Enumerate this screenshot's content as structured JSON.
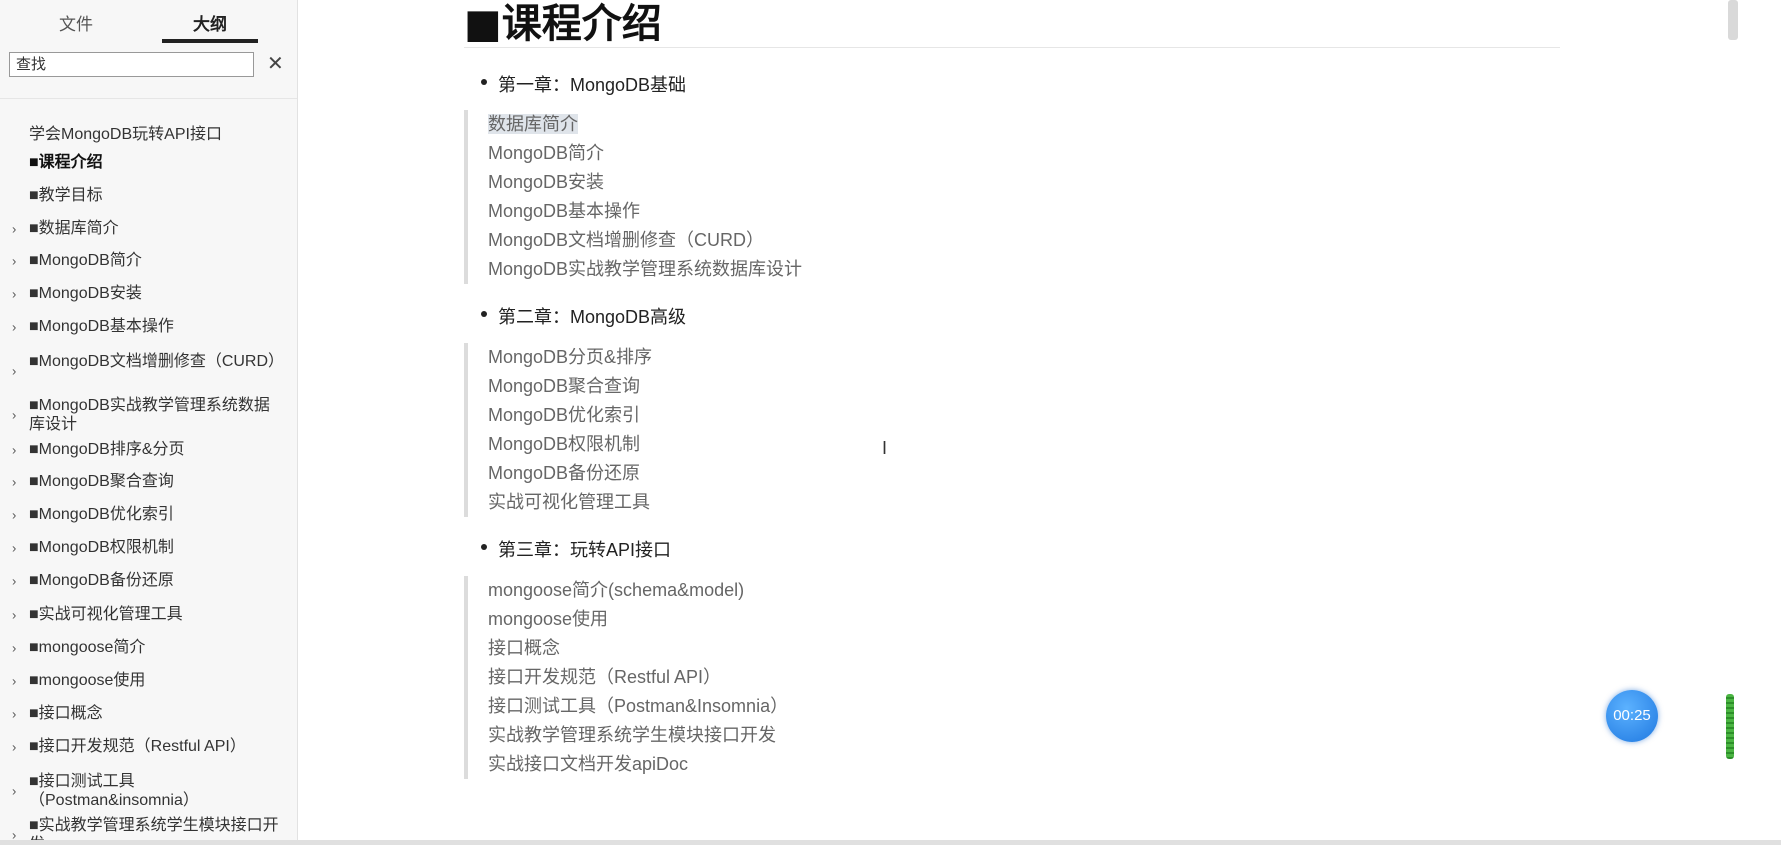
{
  "sidebar": {
    "tabs": {
      "files": "文件",
      "outline": "大纲"
    },
    "search": {
      "placeholder": "查找",
      "close": "✕"
    },
    "items": [
      {
        "label": "学会MongoDB玩转API接口",
        "expandable": false,
        "bold": false
      },
      {
        "label": "■课程介绍",
        "expandable": false,
        "bold": true
      },
      {
        "label": "■教学目标",
        "expandable": false,
        "bold": false
      },
      {
        "label": "■数据库简介",
        "expandable": true,
        "bold": false
      },
      {
        "label": "■MongoDB简介",
        "expandable": true,
        "bold": false
      },
      {
        "label": "■MongoDB安装",
        "expandable": true,
        "bold": false
      },
      {
        "label": "■MongoDB基本操作",
        "expandable": true,
        "bold": false
      },
      {
        "label": "■MongoDB文档增删修查（CURD）",
        "expandable": true,
        "bold": false
      },
      {
        "label": "■MongoDB实战教学管理系统数据库设计",
        "expandable": true,
        "bold": false
      },
      {
        "label": "■MongoDB排序&分页",
        "expandable": true,
        "bold": false
      },
      {
        "label": "■MongoDB聚合查询",
        "expandable": true,
        "bold": false
      },
      {
        "label": "■MongoDB优化索引",
        "expandable": true,
        "bold": false
      },
      {
        "label": "■MongoDB权限机制",
        "expandable": true,
        "bold": false
      },
      {
        "label": "■MongoDB备份还原",
        "expandable": true,
        "bold": false
      },
      {
        "label": "■实战可视化管理工具",
        "expandable": true,
        "bold": false
      },
      {
        "label": "■mongoose简介",
        "expandable": true,
        "bold": false
      },
      {
        "label": "■mongoose使用",
        "expandable": true,
        "bold": false
      },
      {
        "label": "■接口概念",
        "expandable": true,
        "bold": false
      },
      {
        "label": "■接口开发规范（Restful API）",
        "expandable": true,
        "bold": false
      },
      {
        "label": "■接口测试工具（Postman&insomnia）",
        "expandable": true,
        "bold": false
      },
      {
        "label": "■实战教学管理系统学生模块接口开发",
        "expandable": true,
        "bold": false
      }
    ]
  },
  "main": {
    "heading": "■课程介绍",
    "chapters": [
      {
        "title": "第一章：MongoDB基础",
        "items": [
          "数据库简介",
          "MongoDB简介",
          "MongoDB安装",
          "MongoDB基本操作",
          "MongoDB文档增删修查（CURD）",
          "MongoDB实战教学管理系统数据库设计"
        ]
      },
      {
        "title": "第二章：MongoDB高级",
        "items": [
          "MongoDB分页&排序",
          "MongoDB聚合查询",
          "MongoDB优化索引",
          "MongoDB权限机制",
          "MongoDB备份还原",
          "实战可视化管理工具"
        ]
      },
      {
        "title": "第三章：玩转API接口",
        "items": [
          "mongoose简介(schema&model)",
          "mongoose使用",
          "接口概念",
          "接口开发规范（Restful API）",
          "接口测试工具（Postman&Insomnia）",
          "实战教学管理系统学生模块接口开发",
          "实战接口文档开发apiDoc"
        ]
      }
    ]
  },
  "timer": "00:25",
  "colors": {
    "accent": "#1f78e0",
    "indicator": "#4bb543"
  }
}
